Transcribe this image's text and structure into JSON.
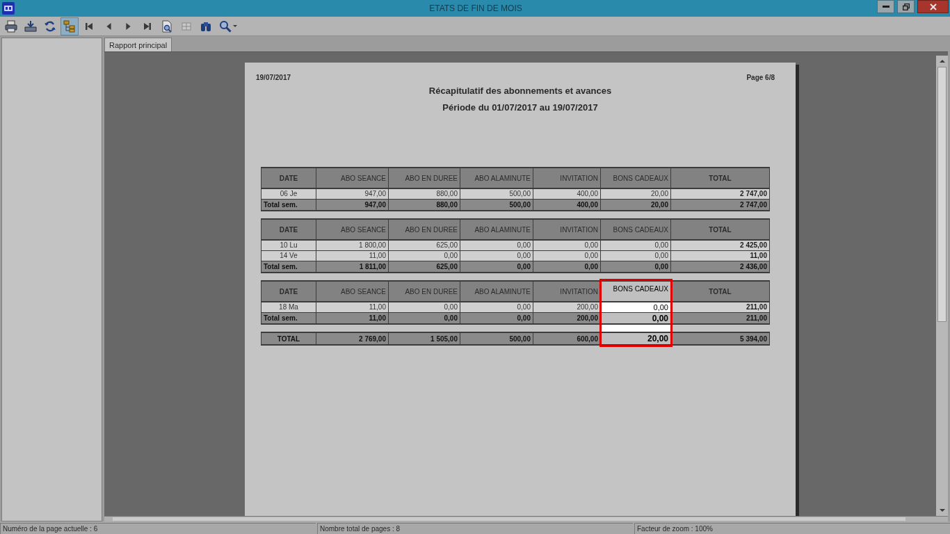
{
  "window": {
    "title": "ETATS DE FIN DE MOIS"
  },
  "toolbar": {
    "buttons": [
      {
        "kind": "print",
        "selected": false
      },
      {
        "kind": "export",
        "selected": false
      },
      {
        "kind": "refresh",
        "selected": false
      },
      {
        "kind": "group-tree",
        "selected": true
      },
      {
        "kind": "first",
        "selected": false
      },
      {
        "kind": "previous",
        "selected": false
      },
      {
        "kind": "next",
        "selected": false
      },
      {
        "kind": "last",
        "selected": false
      },
      {
        "kind": "page-setup",
        "selected": false
      },
      {
        "kind": "grid",
        "selected": false
      },
      {
        "kind": "find",
        "selected": false
      },
      {
        "kind": "zoom",
        "selected": false
      }
    ]
  },
  "tabs": [
    {
      "label": "Rapport principal",
      "selected": true
    }
  ],
  "report": {
    "date": "19/07/2017",
    "page": "Page 6/8",
    "title": "Récapitulatif des abonnements et avances",
    "period": "Période du 01/07/2017 au 19/07/2017",
    "tables": [
      {
        "columns": [
          {
            "label": "DATE",
            "highlighted": false
          },
          {
            "label": "ABO SEANCE",
            "highlighted": false
          },
          {
            "label": "ABO EN DUREE",
            "highlighted": false
          },
          {
            "label": "ABO ALAMINUTE",
            "highlighted": false
          },
          {
            "label": "INVITATION",
            "highlighted": false
          },
          {
            "label": "BONS CADEAUX",
            "highlighted": false
          },
          {
            "label": "TOTAL",
            "highlighted": false
          }
        ],
        "rows": [
          {
            "kind": "day",
            "cells": [
              "06 Je",
              "947,00",
              "880,00",
              "500,00",
              "400,00",
              "20,00",
              "2 747,00"
            ]
          },
          {
            "kind": "subtotal",
            "cells": [
              "Total sem.",
              "947,00",
              "880,00",
              "500,00",
              "400,00",
              "20,00",
              "2 747,00"
            ]
          }
        ]
      },
      {
        "columns": [
          {
            "label": "DATE",
            "highlighted": false
          },
          {
            "label": "ABO SEANCE",
            "highlighted": false
          },
          {
            "label": "ABO EN DUREE",
            "highlighted": false
          },
          {
            "label": "ABO ALAMINUTE",
            "highlighted": false
          },
          {
            "label": "INVITATION",
            "highlighted": false
          },
          {
            "label": "BONS CADEAUX",
            "highlighted": false
          },
          {
            "label": "TOTAL",
            "highlighted": false
          }
        ],
        "rows": [
          {
            "kind": "day",
            "cells": [
              "10 Lu",
              "1 800,00",
              "625,00",
              "0,00",
              "0,00",
              "0,00",
              "2 425,00"
            ]
          },
          {
            "kind": "day",
            "cells": [
              "14 Ve",
              "11,00",
              "0,00",
              "0,00",
              "0,00",
              "0,00",
              "11,00"
            ]
          },
          {
            "kind": "subtotal",
            "cells": [
              "Total sem.",
              "1 811,00",
              "625,00",
              "0,00",
              "0,00",
              "0,00",
              "2 436,00"
            ]
          }
        ]
      },
      {
        "columns": [
          {
            "label": "DATE",
            "highlighted": false
          },
          {
            "label": "ABO SEANCE",
            "highlighted": false
          },
          {
            "label": "ABO EN DUREE",
            "highlighted": false
          },
          {
            "label": "ABO ALAMINUTE",
            "highlighted": false
          },
          {
            "label": "INVITATION",
            "highlighted": false
          },
          {
            "label": "BONS CADEAUX",
            "highlighted": true
          },
          {
            "label": "TOTAL",
            "highlighted": false
          }
        ],
        "rows": [
          {
            "kind": "day",
            "cells": [
              "18 Ma",
              "11,00",
              "0,00",
              "0,00",
              "200,00",
              "0,00",
              "211,00"
            ]
          },
          {
            "kind": "subtotal",
            "cells": [
              "Total sem.",
              "11,00",
              "0,00",
              "0,00",
              "200,00",
              "0,00",
              "211,00"
            ]
          }
        ]
      }
    ],
    "grand_total": {
      "cells": [
        {
          "text": "TOTAL",
          "highlighted": false
        },
        {
          "text": "2 769,00",
          "highlighted": false
        },
        {
          "text": "1 505,00",
          "highlighted": false
        },
        {
          "text": "500,00",
          "highlighted": false
        },
        {
          "text": "600,00",
          "highlighted": false
        },
        {
          "text": "20,00",
          "highlighted": true
        },
        {
          "text": "5 394,00",
          "highlighted": false
        }
      ]
    }
  },
  "status_bar": [
    "Numéro de la page actuelle : 6",
    "Nombre total de pages : 8",
    "Facteur de zoom : 100%"
  ]
}
